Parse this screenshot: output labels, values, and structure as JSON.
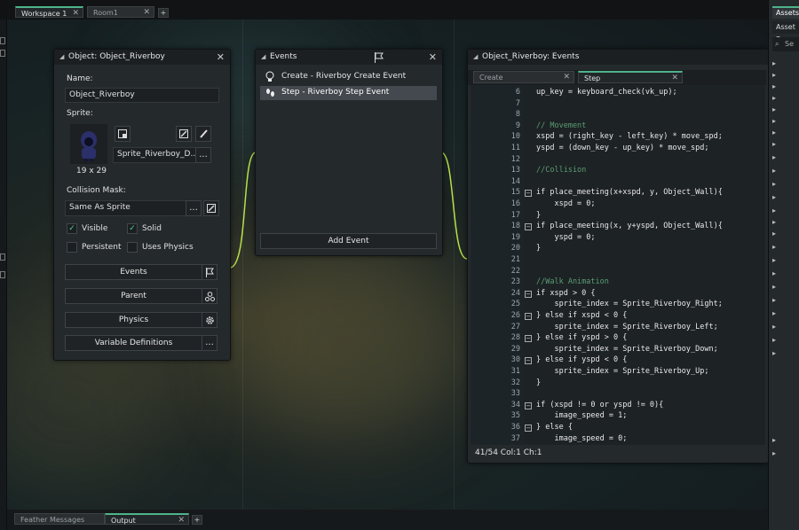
{
  "top_tabs": [
    {
      "label": "Workspace 1",
      "active": true
    },
    {
      "label": "Room1",
      "active": false
    }
  ],
  "object_panel": {
    "title": "Object: Object_Riverboy",
    "name_label": "Name:",
    "name_value": "Object_Riverboy",
    "sprite_label": "Sprite:",
    "sprite_size": "19 x 29",
    "sprite_name": "Sprite_Riverboy_D...",
    "collision_label": "Collision Mask:",
    "collision_value": "Same As Sprite",
    "visible_label": "Visible",
    "solid_label": "Solid",
    "persistent_label": "Persistent",
    "physics_check_label": "Uses Physics",
    "events_btn": "Events",
    "parent_btn": "Parent",
    "physics_btn": "Physics",
    "vars_btn": "Variable Definitions",
    "dots": "..."
  },
  "events_panel": {
    "title": "Events",
    "items": [
      {
        "label": "Create - Riverboy Create Event"
      },
      {
        "label": "Step - Riverboy Step Event"
      }
    ],
    "add_btn": "Add Event"
  },
  "code_panel": {
    "title": "Object_Riverboy: Events",
    "tabs": [
      {
        "label": "Create",
        "active": false
      },
      {
        "label": "Step",
        "active": true
      }
    ],
    "status": "41/54 Col:1 Ch:1",
    "lines": [
      {
        "n": "6",
        "text": "up_key = keyboard_check(vk_up);"
      },
      {
        "n": "7",
        "text": ""
      },
      {
        "n": "8",
        "text": ""
      },
      {
        "n": "9",
        "text": "// Movement"
      },
      {
        "n": "10",
        "text": "xspd = (right_key - left_key) * move_spd;"
      },
      {
        "n": "11",
        "text": "yspd = (down_key - up_key) * move_spd;"
      },
      {
        "n": "12",
        "text": ""
      },
      {
        "n": "13",
        "text": "//Collision"
      },
      {
        "n": "14",
        "text": ""
      },
      {
        "n": "15",
        "text": "if place_meeting(x+xspd, y, Object_Wall){"
      },
      {
        "n": "16",
        "text": "    xspd = 0;"
      },
      {
        "n": "17",
        "text": "}"
      },
      {
        "n": "18",
        "text": "if place_meeting(x, y+yspd, Object_Wall){"
      },
      {
        "n": "19",
        "text": "    yspd = 0;"
      },
      {
        "n": "20",
        "text": "}"
      },
      {
        "n": "21",
        "text": ""
      },
      {
        "n": "22",
        "text": ""
      },
      {
        "n": "23",
        "text": "//Walk Animation"
      },
      {
        "n": "24",
        "text": "if xspd > 0 {"
      },
      {
        "n": "25",
        "text": "    sprite_index = Sprite_Riverboy_Right;"
      },
      {
        "n": "26",
        "text": "} else if xspd < 0 {"
      },
      {
        "n": "27",
        "text": "    sprite_index = Sprite_Riverboy_Left;"
      },
      {
        "n": "28",
        "text": "} else if yspd > 0 {"
      },
      {
        "n": "29",
        "text": "    sprite_index = Sprite_Riverboy_Down;"
      },
      {
        "n": "30",
        "text": "} else if yspd < 0 {"
      },
      {
        "n": "31",
        "text": "    sprite_index = Sprite_Riverboy_Up;"
      },
      {
        "n": "32",
        "text": "}"
      },
      {
        "n": "33",
        "text": ""
      },
      {
        "n": "34",
        "text": "if (xspd != 0 or yspd != 0){"
      },
      {
        "n": "35",
        "text": "    image_speed = 1;"
      },
      {
        "n": "36",
        "text": "} else {"
      },
      {
        "n": "37",
        "text": "    image_speed = 0;"
      }
    ]
  },
  "right_panel": {
    "tab_assets": "Assets",
    "tab_browser": "Asset B",
    "search_placeholder": "Se"
  },
  "bottom_tabs": [
    {
      "label": "Feather Messages",
      "active": false
    },
    {
      "label": "Output",
      "active": true
    }
  ],
  "icons": {
    "flag": "flag-icon",
    "parent": "hierarchy-icon",
    "physics": "gear-icon",
    "edit": "pencil-icon",
    "brush": "brush-icon",
    "new_sprite": "new-sprite-icon"
  }
}
